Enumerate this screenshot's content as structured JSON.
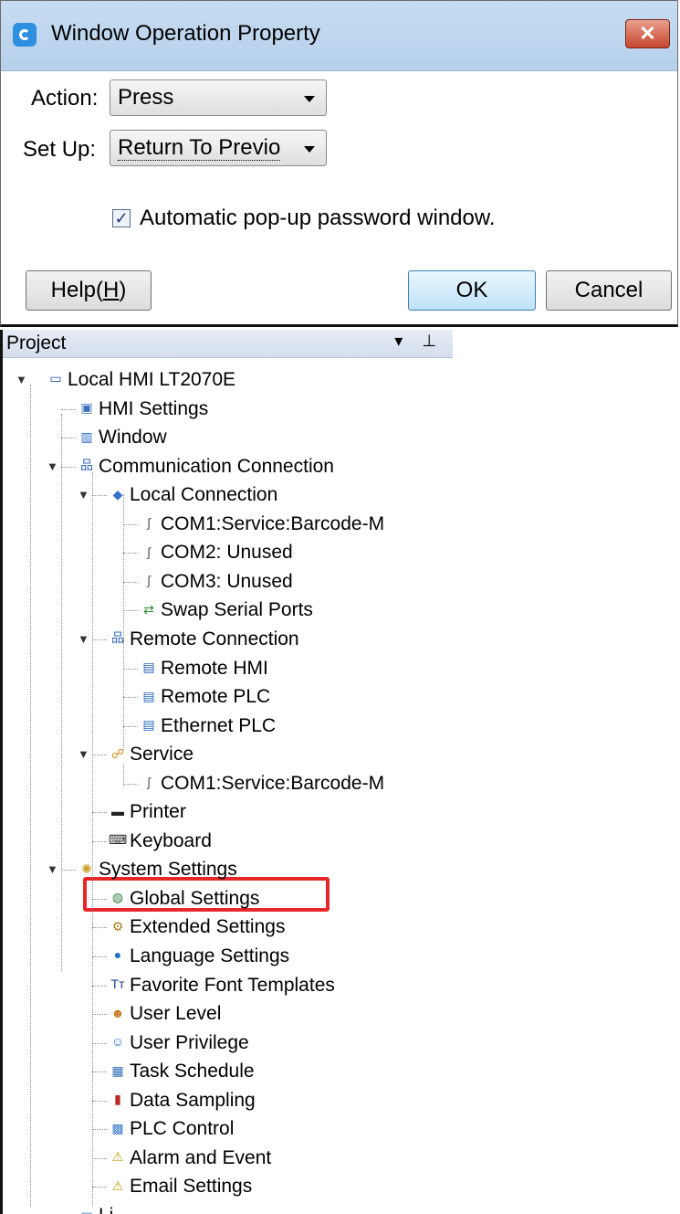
{
  "dialog": {
    "title": "Window Operation Property",
    "close_label": "✕",
    "action_label": "Action:",
    "action_value": "Press",
    "setup_label": "Set Up:",
    "setup_value": "Return To Previo",
    "checkbox_label": "Automatic pop-up password window.",
    "checkbox_checked": true,
    "help_label": "Help(",
    "help_key": "H",
    "help_close": ")",
    "ok_label": "OK",
    "cancel_label": "Cancel"
  },
  "project": {
    "title": "Project",
    "tools": "▾ ⊥",
    "items": [
      {
        "label": "Local HMI LT2070E",
        "icon": "monitor-icon"
      },
      {
        "label": "HMI Settings",
        "icon": "hmi-settings-icon"
      },
      {
        "label": "Window",
        "icon": "window-icon"
      },
      {
        "label": "Communication Connection",
        "icon": "network-icon"
      },
      {
        "label": "Local Connection",
        "icon": "local-connection-icon"
      },
      {
        "label": "COM1:Service:Barcode-M",
        "icon": "serial-port-icon"
      },
      {
        "label": "COM2: Unused",
        "icon": "serial-port-icon"
      },
      {
        "label": "COM3: Unused",
        "icon": "serial-port-icon"
      },
      {
        "label": "Swap Serial Ports",
        "icon": "swap-ports-icon"
      },
      {
        "label": "Remote Connection",
        "icon": "network-icon"
      },
      {
        "label": "Remote HMI",
        "icon": "remote-hmi-icon"
      },
      {
        "label": "Remote PLC",
        "icon": "remote-plc-icon"
      },
      {
        "label": "Ethernet PLC",
        "icon": "ethernet-plc-icon"
      },
      {
        "label": "Service",
        "icon": "service-icon"
      },
      {
        "label": "COM1:Service:Barcode-M",
        "icon": "serial-port-icon"
      },
      {
        "label": "Printer",
        "icon": "printer-icon"
      },
      {
        "label": "Keyboard",
        "icon": "keyboard-icon"
      },
      {
        "label": "System Settings",
        "icon": "system-settings-icon"
      },
      {
        "label": "Global Settings",
        "icon": "global-settings-icon"
      },
      {
        "label": "Extended Settings",
        "icon": "extended-settings-icon"
      },
      {
        "label": "Language Settings",
        "icon": "language-icon"
      },
      {
        "label": "Favorite Font Templates",
        "icon": "font-icon"
      },
      {
        "label": "User Level",
        "icon": "user-level-icon"
      },
      {
        "label": "User Privilege",
        "icon": "user-privilege-icon"
      },
      {
        "label": "Task Schedule",
        "icon": "calendar-icon"
      },
      {
        "label": "Data Sampling",
        "icon": "bar-chart-icon"
      },
      {
        "label": "PLC Control",
        "icon": "plc-control-icon"
      },
      {
        "label": "Alarm and Event",
        "icon": "alarm-icon"
      },
      {
        "label": "Email Settings",
        "icon": "email-alarm-icon"
      },
      {
        "label": "Li",
        "icon": "library-icon"
      }
    ]
  }
}
